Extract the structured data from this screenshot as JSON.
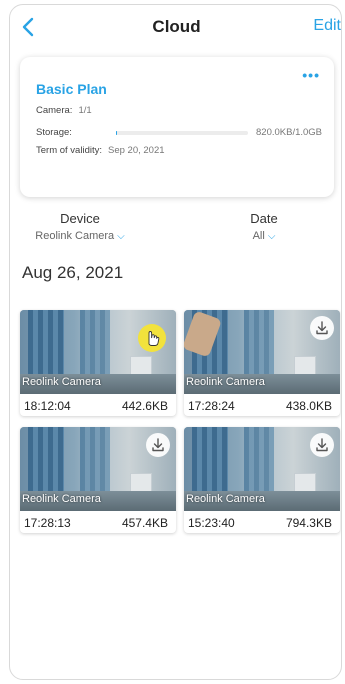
{
  "header": {
    "title": "Cloud",
    "edit_label": "Edit"
  },
  "plan": {
    "name": "Basic Plan",
    "more_label": "•••",
    "camera_label": "Camera:",
    "camera_value": "1/1",
    "storage_label": "Storage:",
    "storage_value": "820.0KB/1.0GB",
    "storage_used_fraction": 0.0008,
    "validity_label": "Term of validity:",
    "validity_value": "Sep 20, 2021"
  },
  "filters": {
    "device_label": "Device",
    "device_value": "Reolink Camera",
    "date_label": "Date",
    "date_value": "All"
  },
  "section_date": "Aug 26, 2021",
  "clips": [
    {
      "camera": "Reolink Camera",
      "time": "18:12:04",
      "size": "442.6KB"
    },
    {
      "camera": "Reolink Camera",
      "time": "17:28:24",
      "size": "438.0KB"
    },
    {
      "camera": "Reolink Camera",
      "time": "17:28:13",
      "size": "457.4KB"
    },
    {
      "camera": "Reolink Camera",
      "time": "15:23:40",
      "size": "794.3KB"
    }
  ],
  "colors": {
    "accent": "#29a3e5",
    "cursor_highlight": "#f2e23c"
  },
  "icons": {
    "back": "chevron-left-icon",
    "more": "more-dots-icon",
    "download": "download-icon",
    "chevron": "chevron-down-icon",
    "cursor": "hand-pointer-icon"
  }
}
